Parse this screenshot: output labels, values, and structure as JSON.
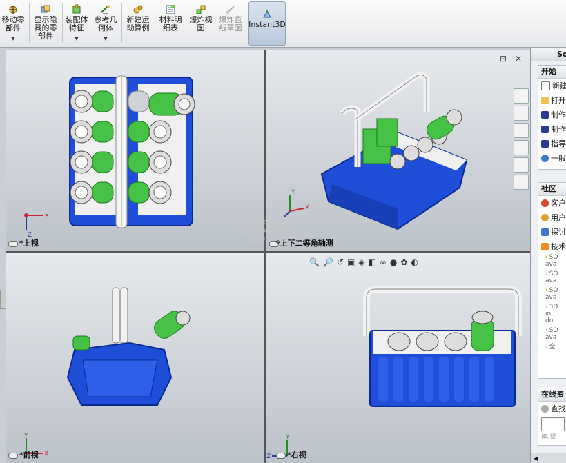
{
  "toolbar": {
    "items": [
      {
        "label": "移动零\n部件",
        "icon": "move-component-icon"
      },
      {
        "label": "显示隐\n藏的零\n部件",
        "icon": "show-hidden-icon"
      },
      {
        "label": "装配体\n特征",
        "icon": "assembly-feature-icon"
      },
      {
        "label": "参考几\n何体",
        "icon": "reference-geometry-icon"
      },
      {
        "label": "新建运\n动算例",
        "icon": "new-motion-study-icon"
      },
      {
        "label": "材料明\n细表",
        "icon": "bill-of-materials-icon"
      },
      {
        "label": "爆炸视\n图",
        "icon": "exploded-view-icon"
      },
      {
        "label": "爆炸直\n线草图",
        "icon": "explode-line-sketch-icon"
      },
      {
        "label": "Instant3D",
        "icon": "instant3d-icon"
      }
    ]
  },
  "viewports": {
    "top_left": "*上视",
    "top_right": "*上下二等角轴测",
    "bottom_left": "*前视",
    "bottom_right": "*右视"
  },
  "axes": {
    "x": "X",
    "y": "Y",
    "z": "Z"
  },
  "watermark": {
    "text": "沐风网",
    "url": "www.mfcad.com"
  },
  "window_controls": {
    "minimize": "–",
    "restore": "⊟",
    "close": "✕"
  },
  "task_pane": {
    "header": "So",
    "start": {
      "title": "开始",
      "items": [
        "新建",
        "打开",
        "制作",
        "制作",
        "指导",
        "一般"
      ]
    },
    "community": {
      "title": "社区",
      "items": [
        "客户",
        "用户",
        "探讨",
        "技术"
      ],
      "feed": [
        [
          "SO",
          "ava"
        ],
        [
          "SO",
          "ava"
        ],
        [
          "SO",
          "ava"
        ],
        [
          "3D",
          "in",
          "do"
        ],
        [
          "SO",
          "ava"
        ]
      ],
      "more": "全"
    },
    "online": {
      "title": "在线资",
      "search": "查找",
      "hint": "如, 疑"
    }
  },
  "colors": {
    "model_blue": "#1f4fd8",
    "model_green": "#46c346",
    "model_white": "#f0f0f0"
  }
}
